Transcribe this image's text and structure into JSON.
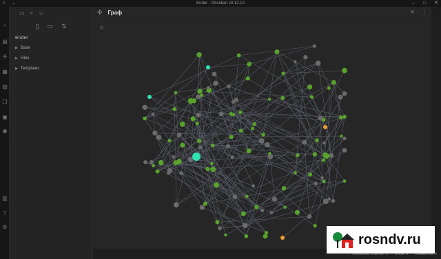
{
  "window": {
    "title": "Ender - Obsidian v0.12.10"
  },
  "sidebar": {
    "vault_name": "Ender",
    "items": [
      {
        "label": "Base"
      },
      {
        "label": "Files"
      },
      {
        "label": "Templates"
      }
    ]
  },
  "graph_view": {
    "title": "Граф"
  },
  "status_bar": {
    "backlinks": "Обратных ссылок: 0",
    "words": "Слов: 0",
    "chars": "Символов: 0"
  },
  "watermark": {
    "text": "rosndv.ru"
  },
  "colors": {
    "green": "#59a32c",
    "gray": "#6b6b6b",
    "teal": "#2fe3b2",
    "orange": "#f0a030",
    "edge": "#555a66"
  }
}
